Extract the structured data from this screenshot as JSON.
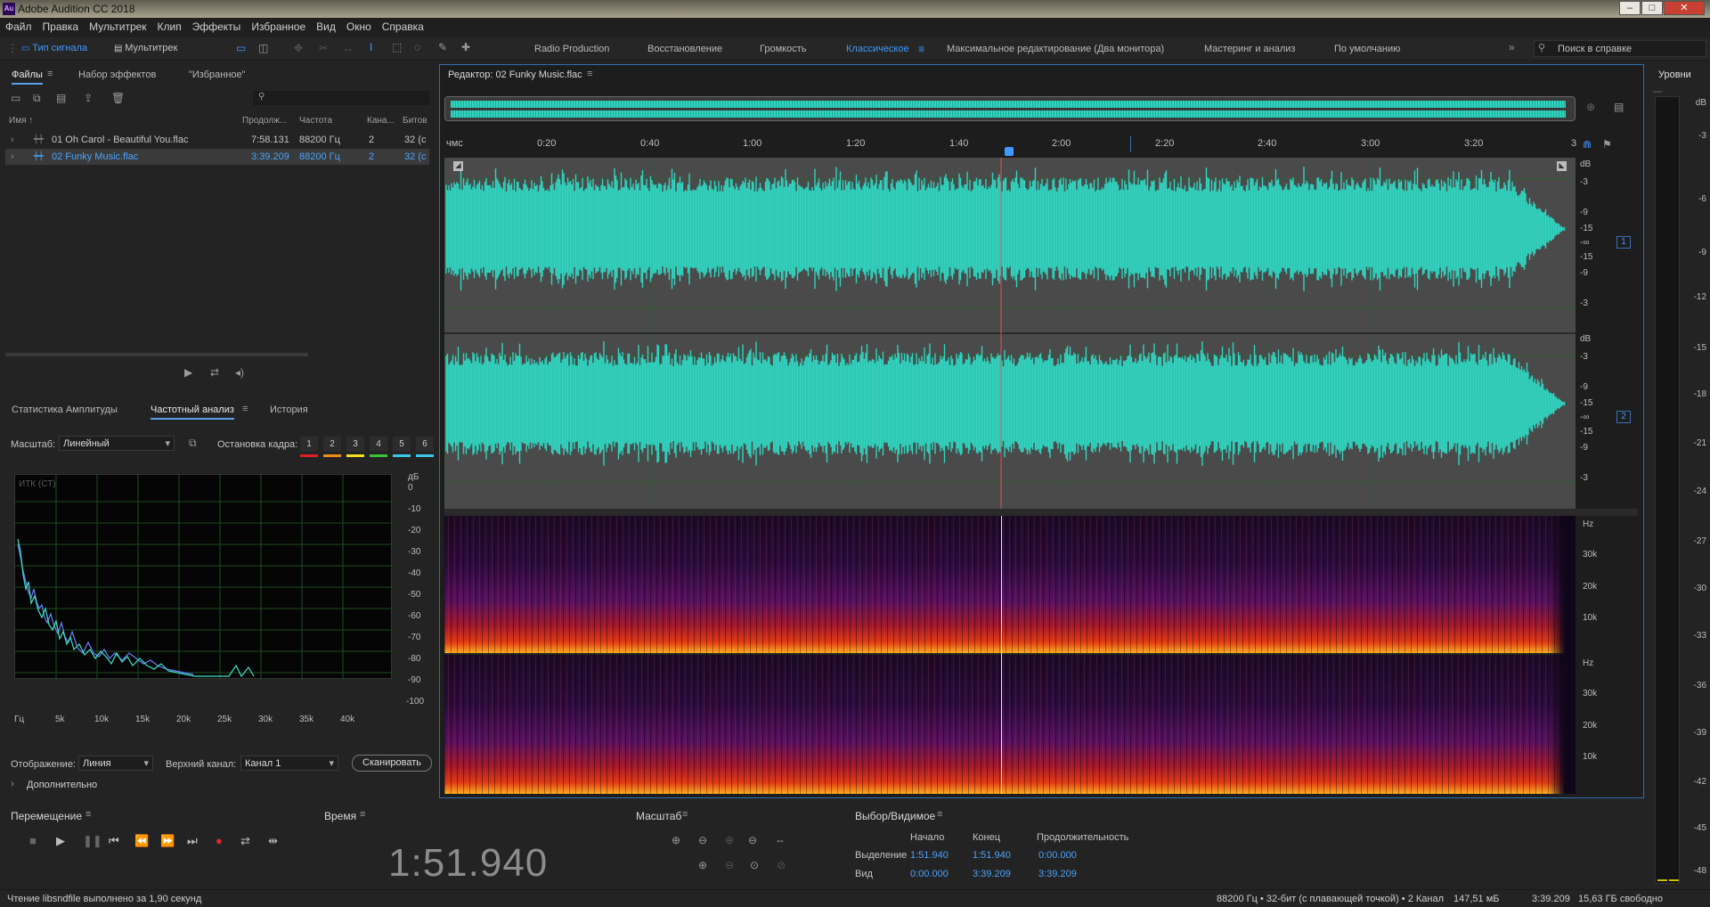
{
  "window": {
    "title": "Adobe Audition CC 2018",
    "logo": "Au"
  },
  "menu": [
    "Файл",
    "Правка",
    "Мультитрек",
    "Клип",
    "Эффекты",
    "Избранное",
    "Вид",
    "Окно",
    "Справка"
  ],
  "toolbar": {
    "mode_waveform": "Тип сигнала",
    "mode_multitrack": "Мультитрек",
    "workspaces": [
      "Radio Production",
      "Восстановление",
      "Громкость",
      "Классическое",
      "Максимальное редактирование (Два монитора)",
      "Мастеринг и анализ",
      "По умолчанию"
    ],
    "active_workspace": "Классическое",
    "search_placeholder": "Поиск в справке"
  },
  "files_panel": {
    "tabs": [
      "Файлы",
      "Набор эффектов",
      "\"Избранное\""
    ],
    "columns": [
      "Имя",
      "Продолж...",
      "Частота",
      "Кана...",
      "Битов"
    ],
    "rows": [
      {
        "name": "01 Oh Carol - Beautiful You.flac",
        "duration": "7:58.131",
        "rate": "88200 Гц",
        "channels": "2",
        "bits": "32 (с"
      },
      {
        "name": "02 Funky Music.flac",
        "duration": "3:39.209",
        "rate": "88200 Гц",
        "channels": "2",
        "bits": "32 (с"
      }
    ]
  },
  "analysis_panel": {
    "tabs": [
      "Статистика Амплитуды",
      "Частотный анализ",
      "История"
    ],
    "scale_label": "Масштаб:",
    "scale_value": "Линейный",
    "freeze_label": "Остановка кадра:",
    "freeze_buttons": [
      "1",
      "2",
      "3",
      "4",
      "5",
      "6"
    ],
    "freeze_colors": [
      "#e02020",
      "#f08a1a",
      "#f0e020",
      "#39c43a",
      "#3cc6e8",
      "#3cc6e8"
    ],
    "plot_label": "ИТК (СТ)",
    "db_unit": "дБ",
    "db_ticks": [
      "0",
      "-10",
      "-20",
      "-30",
      "-40",
      "-50",
      "-60",
      "-70",
      "-80",
      "-90",
      "-100"
    ],
    "hz_ticks": [
      "Гц",
      "5k",
      "10k",
      "15k",
      "20k",
      "25k",
      "30k",
      "35k",
      "40k"
    ],
    "display_label": "Отображение:",
    "display_value": "Линия",
    "channel_label": "Верхний канал:",
    "channel_value": "Канал 1",
    "scan_button": "Сканировать",
    "advanced": "Дополнительно"
  },
  "editor": {
    "title": "Редактор: 02 Funky Music.flac",
    "ruler_unit": "чмс",
    "ruler_ticks": [
      "0:20",
      "0:40",
      "1:00",
      "1:20",
      "1:40",
      "2:00",
      "2:20",
      "2:40",
      "3:00",
      "3:20",
      "3"
    ],
    "db_label": "dB",
    "db_scale": [
      "-3",
      "-9",
      "-15",
      "-∞",
      "-15",
      "-9",
      "-3"
    ],
    "channels": [
      "1",
      "2"
    ],
    "hz_label": "Hz",
    "hz_scale": [
      "30k",
      "20k",
      "10k"
    ]
  },
  "levels_panel": {
    "title": "Уровни",
    "ticks": [
      "dB",
      "-3",
      "-6",
      "-9",
      "-12",
      "-15",
      "-18",
      "-21",
      "-24",
      "-27",
      "-30",
      "-33",
      "-36",
      "-39",
      "-42",
      "-45",
      "-48"
    ]
  },
  "transport": {
    "title": "Перемещение"
  },
  "time_panel": {
    "title": "Время",
    "value": "1:51.940"
  },
  "zoom_panel": {
    "title": "Масштаб"
  },
  "selection_panel": {
    "title": "Выбор/Видимое",
    "col_start": "Начало",
    "col_end": "Конец",
    "col_duration": "Продолжительность",
    "selection_label": "Выделение",
    "selection": [
      "1:51.940",
      "1:51.940",
      "0:00.000"
    ],
    "view_label": "Вид",
    "view": [
      "0:00.000",
      "3:39.209",
      "3:39.209"
    ]
  },
  "status": {
    "message": "Чтение libsndfile выполнено за 1,90 секунд",
    "format": "88200 Гц • 32-бит (с плавающей точкой) • 2 Канал",
    "size": "147,51 мБ",
    "duration": "3:39.209",
    "free": "15,63 ГБ свободно"
  },
  "colors": {
    "accent": "#3d9bff",
    "waveform": "#2fd5c0",
    "playhead": "#e05050"
  }
}
